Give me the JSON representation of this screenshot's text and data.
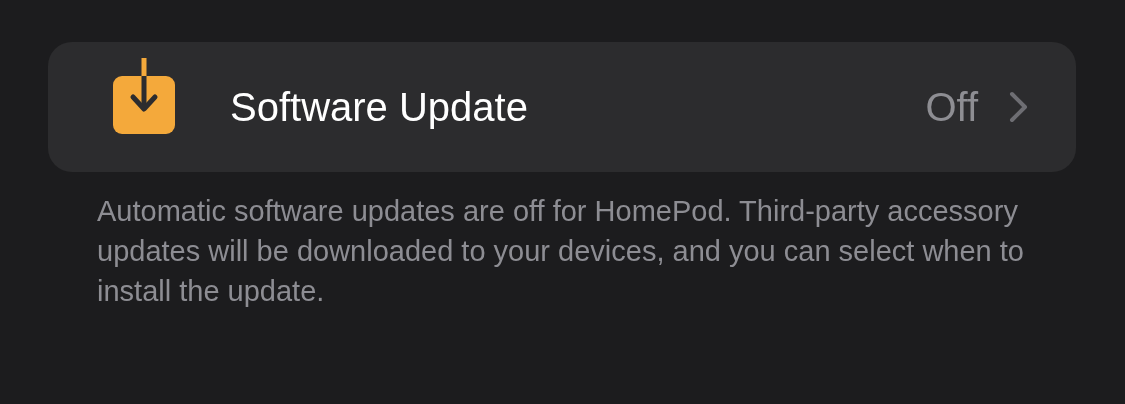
{
  "settings_row": {
    "title": "Software Update",
    "value": "Off"
  },
  "footer": "Automatic software updates are off for HomePod. Third-party accessory updates will be downloaded to your devices, and you can select when to install the update."
}
